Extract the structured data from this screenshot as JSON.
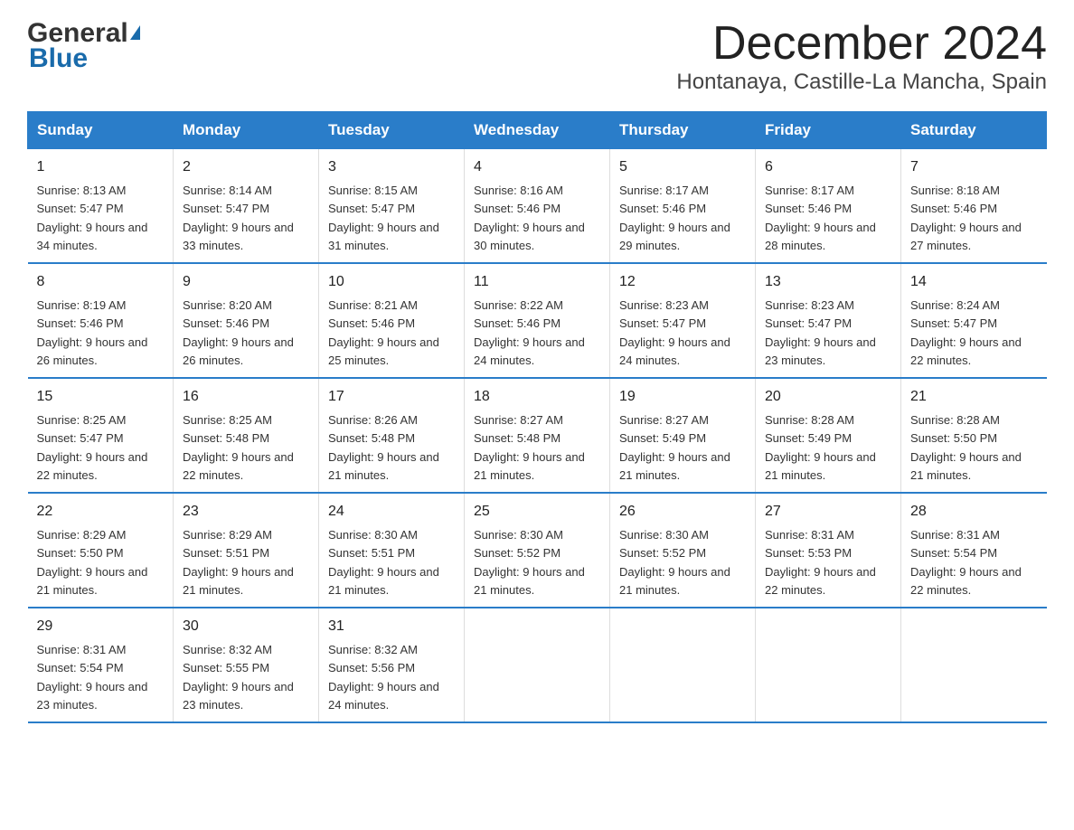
{
  "logo": {
    "general": "General",
    "blue": "Blue"
  },
  "title": "December 2024",
  "subtitle": "Hontanaya, Castille-La Mancha, Spain",
  "headers": [
    "Sunday",
    "Monday",
    "Tuesday",
    "Wednesday",
    "Thursday",
    "Friday",
    "Saturday"
  ],
  "weeks": [
    [
      {
        "day": "1",
        "sunrise": "8:13 AM",
        "sunset": "5:47 PM",
        "daylight": "9 hours and 34 minutes."
      },
      {
        "day": "2",
        "sunrise": "8:14 AM",
        "sunset": "5:47 PM",
        "daylight": "9 hours and 33 minutes."
      },
      {
        "day": "3",
        "sunrise": "8:15 AM",
        "sunset": "5:47 PM",
        "daylight": "9 hours and 31 minutes."
      },
      {
        "day": "4",
        "sunrise": "8:16 AM",
        "sunset": "5:46 PM",
        "daylight": "9 hours and 30 minutes."
      },
      {
        "day": "5",
        "sunrise": "8:17 AM",
        "sunset": "5:46 PM",
        "daylight": "9 hours and 29 minutes."
      },
      {
        "day": "6",
        "sunrise": "8:17 AM",
        "sunset": "5:46 PM",
        "daylight": "9 hours and 28 minutes."
      },
      {
        "day": "7",
        "sunrise": "8:18 AM",
        "sunset": "5:46 PM",
        "daylight": "9 hours and 27 minutes."
      }
    ],
    [
      {
        "day": "8",
        "sunrise": "8:19 AM",
        "sunset": "5:46 PM",
        "daylight": "9 hours and 26 minutes."
      },
      {
        "day": "9",
        "sunrise": "8:20 AM",
        "sunset": "5:46 PM",
        "daylight": "9 hours and 26 minutes."
      },
      {
        "day": "10",
        "sunrise": "8:21 AM",
        "sunset": "5:46 PM",
        "daylight": "9 hours and 25 minutes."
      },
      {
        "day": "11",
        "sunrise": "8:22 AM",
        "sunset": "5:46 PM",
        "daylight": "9 hours and 24 minutes."
      },
      {
        "day": "12",
        "sunrise": "8:23 AM",
        "sunset": "5:47 PM",
        "daylight": "9 hours and 24 minutes."
      },
      {
        "day": "13",
        "sunrise": "8:23 AM",
        "sunset": "5:47 PM",
        "daylight": "9 hours and 23 minutes."
      },
      {
        "day": "14",
        "sunrise": "8:24 AM",
        "sunset": "5:47 PM",
        "daylight": "9 hours and 22 minutes."
      }
    ],
    [
      {
        "day": "15",
        "sunrise": "8:25 AM",
        "sunset": "5:47 PM",
        "daylight": "9 hours and 22 minutes."
      },
      {
        "day": "16",
        "sunrise": "8:25 AM",
        "sunset": "5:48 PM",
        "daylight": "9 hours and 22 minutes."
      },
      {
        "day": "17",
        "sunrise": "8:26 AM",
        "sunset": "5:48 PM",
        "daylight": "9 hours and 21 minutes."
      },
      {
        "day": "18",
        "sunrise": "8:27 AM",
        "sunset": "5:48 PM",
        "daylight": "9 hours and 21 minutes."
      },
      {
        "day": "19",
        "sunrise": "8:27 AM",
        "sunset": "5:49 PM",
        "daylight": "9 hours and 21 minutes."
      },
      {
        "day": "20",
        "sunrise": "8:28 AM",
        "sunset": "5:49 PM",
        "daylight": "9 hours and 21 minutes."
      },
      {
        "day": "21",
        "sunrise": "8:28 AM",
        "sunset": "5:50 PM",
        "daylight": "9 hours and 21 minutes."
      }
    ],
    [
      {
        "day": "22",
        "sunrise": "8:29 AM",
        "sunset": "5:50 PM",
        "daylight": "9 hours and 21 minutes."
      },
      {
        "day": "23",
        "sunrise": "8:29 AM",
        "sunset": "5:51 PM",
        "daylight": "9 hours and 21 minutes."
      },
      {
        "day": "24",
        "sunrise": "8:30 AM",
        "sunset": "5:51 PM",
        "daylight": "9 hours and 21 minutes."
      },
      {
        "day": "25",
        "sunrise": "8:30 AM",
        "sunset": "5:52 PM",
        "daylight": "9 hours and 21 minutes."
      },
      {
        "day": "26",
        "sunrise": "8:30 AM",
        "sunset": "5:52 PM",
        "daylight": "9 hours and 21 minutes."
      },
      {
        "day": "27",
        "sunrise": "8:31 AM",
        "sunset": "5:53 PM",
        "daylight": "9 hours and 22 minutes."
      },
      {
        "day": "28",
        "sunrise": "8:31 AM",
        "sunset": "5:54 PM",
        "daylight": "9 hours and 22 minutes."
      }
    ],
    [
      {
        "day": "29",
        "sunrise": "8:31 AM",
        "sunset": "5:54 PM",
        "daylight": "9 hours and 23 minutes."
      },
      {
        "day": "30",
        "sunrise": "8:32 AM",
        "sunset": "5:55 PM",
        "daylight": "9 hours and 23 minutes."
      },
      {
        "day": "31",
        "sunrise": "8:32 AM",
        "sunset": "5:56 PM",
        "daylight": "9 hours and 24 minutes."
      },
      null,
      null,
      null,
      null
    ]
  ]
}
